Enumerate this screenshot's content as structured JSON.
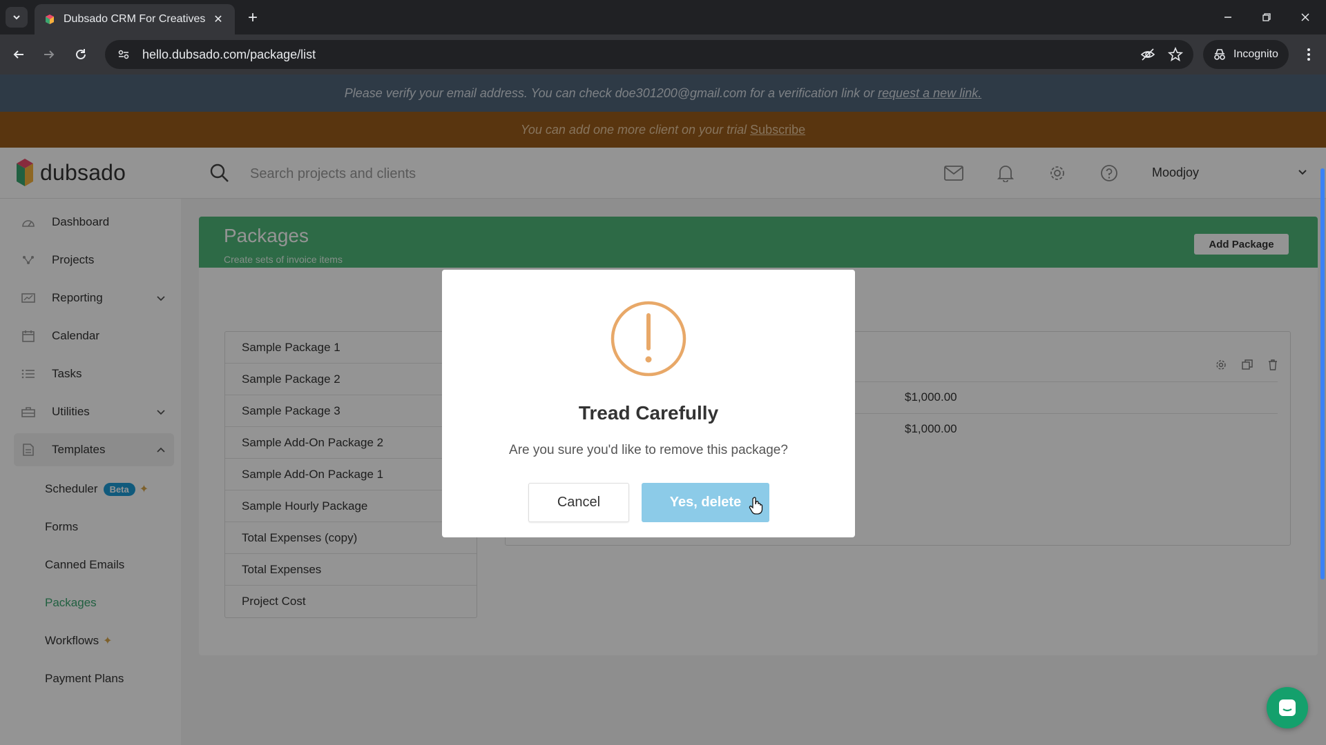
{
  "browser": {
    "tab_title": "Dubsado CRM For Creatives",
    "url": "hello.dubsado.com/package/list",
    "incognito_label": "Incognito"
  },
  "banners": {
    "verify_text": "Please verify your email address. You can check doe301200@gmail.com for a verification link or",
    "verify_link": "request a new link.",
    "trial_text": "You can add one more client on your trial",
    "trial_link": "Subscribe"
  },
  "header": {
    "logo_text": "dubsado",
    "search_placeholder": "Search projects and clients",
    "user_name": "Moodjoy"
  },
  "sidebar": {
    "items": [
      {
        "label": "Dashboard",
        "icon": "dashboard-icon"
      },
      {
        "label": "Projects",
        "icon": "projects-icon"
      },
      {
        "label": "Reporting",
        "icon": "reporting-icon",
        "chevron": "down"
      },
      {
        "label": "Calendar",
        "icon": "calendar-icon"
      },
      {
        "label": "Tasks",
        "icon": "tasks-icon"
      },
      {
        "label": "Utilities",
        "icon": "utilities-icon",
        "chevron": "down"
      },
      {
        "label": "Templates",
        "icon": "templates-icon",
        "chevron": "up"
      }
    ],
    "sub_items": [
      {
        "label": "Scheduler",
        "badge": "Beta",
        "sparkle": true
      },
      {
        "label": "Forms"
      },
      {
        "label": "Canned Emails"
      },
      {
        "label": "Packages",
        "active": true
      },
      {
        "label": "Workflows",
        "sparkle": true
      },
      {
        "label": "Payment Plans"
      }
    ]
  },
  "packages_page": {
    "title": "Packages",
    "subtitle": "Create sets of invoice items",
    "add_button": "Add Package",
    "list": [
      "Sample Package 1",
      "Sample Package 2",
      "Sample Package 3",
      "Sample Add-On Package 2",
      "Sample Add-On Package 1",
      "Sample Hourly Package",
      "Total Expenses (copy)",
      "Total Expenses",
      "Project Cost"
    ],
    "detail_prices": [
      "$1,000.00",
      "$1,000.00"
    ]
  },
  "modal": {
    "title": "Tread Carefully",
    "message": "Are you sure you'd like to remove this package?",
    "cancel_label": "Cancel",
    "confirm_label": "Yes, delete"
  },
  "colors": {
    "brand_green": "#4eb779",
    "active_nav": "#3aa670",
    "warning_orange": "#e8a868",
    "confirm_blue": "#8ccbe8",
    "verify_banner": "#506479",
    "trial_banner": "#9a5c1a"
  }
}
